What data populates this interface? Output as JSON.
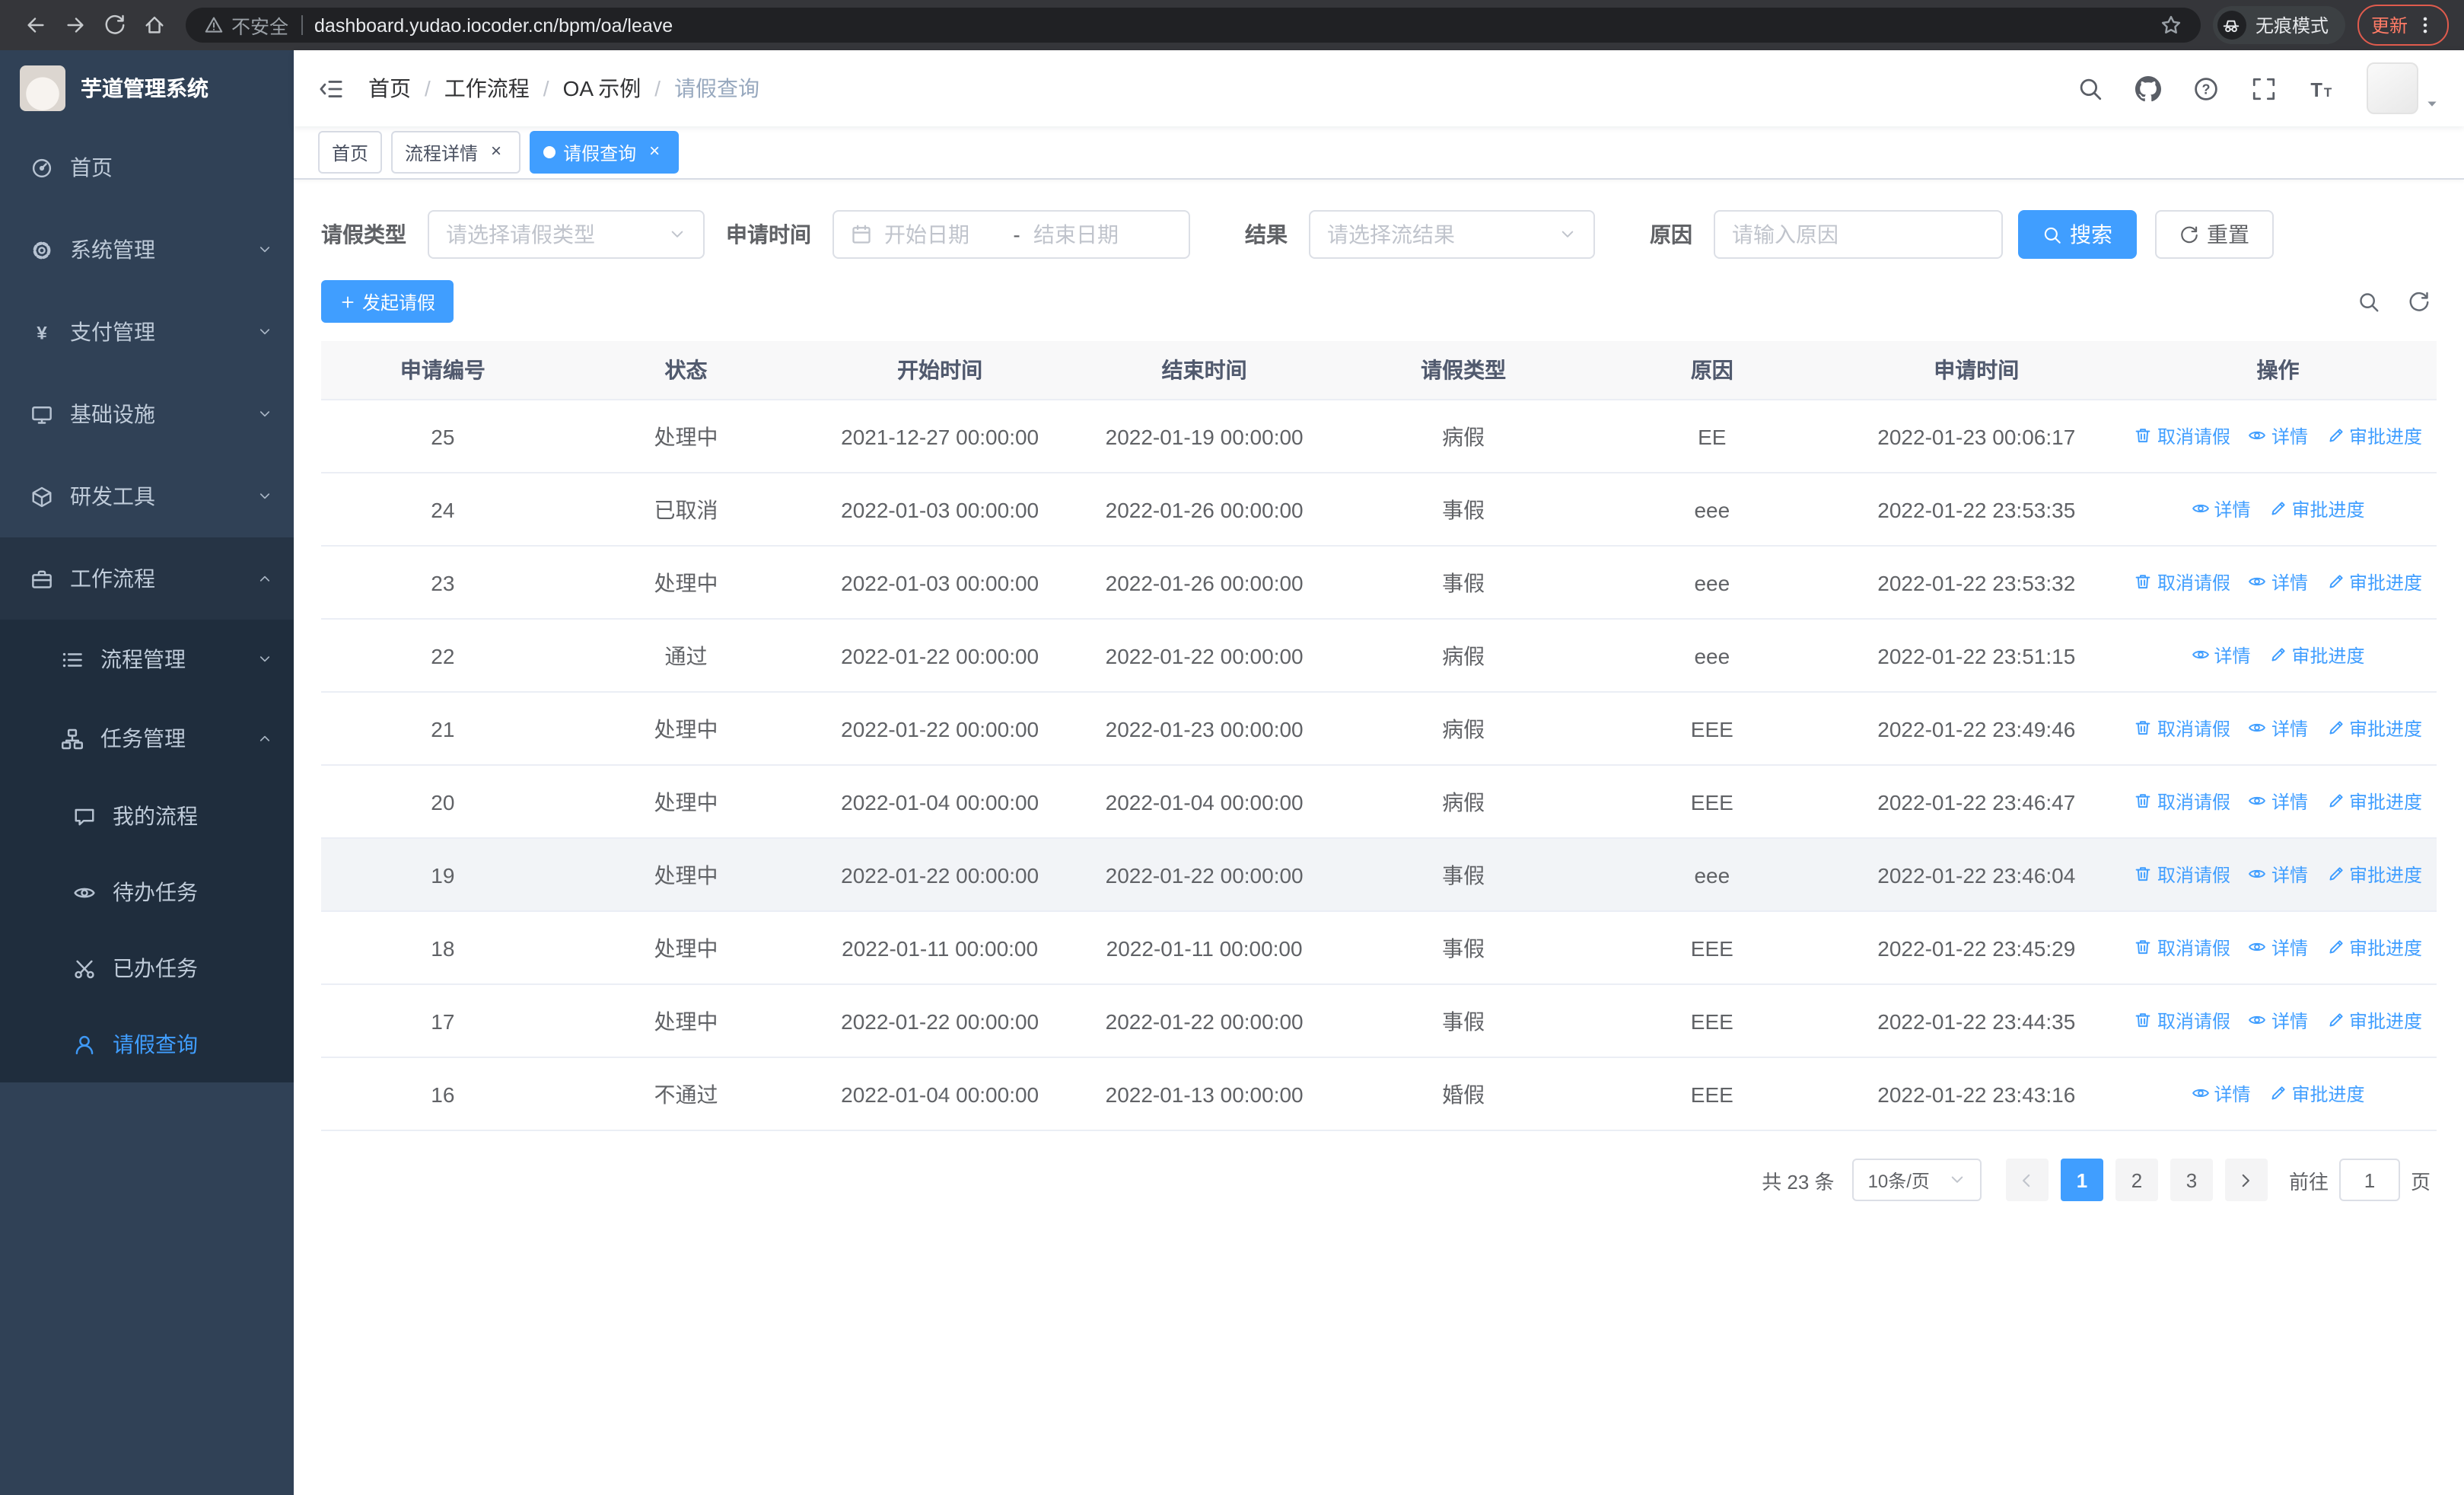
{
  "browser": {
    "security_warning": "不安全",
    "url": "dashboard.yudao.iocoder.cn/bpm/oa/leave",
    "incognito_label": "无痕模式",
    "update_label": "更新"
  },
  "sidebar": {
    "logo_title": "芋道管理系统",
    "menu": [
      {
        "name": "home",
        "label": "首页",
        "icon": "dashboard-icon",
        "level": 1
      },
      {
        "name": "system-management",
        "label": "系统管理",
        "icon": "gear-icon",
        "level": 1,
        "arrow": "down"
      },
      {
        "name": "payment-management",
        "label": "支付管理",
        "icon": "yen-icon",
        "level": 1,
        "arrow": "down"
      },
      {
        "name": "infrastructure",
        "label": "基础设施",
        "icon": "monitor-icon",
        "level": 1,
        "arrow": "down"
      },
      {
        "name": "dev-tools",
        "label": "研发工具",
        "icon": "tools-icon",
        "level": 1,
        "arrow": "down"
      },
      {
        "name": "workflow",
        "label": "工作流程",
        "icon": "briefcase-icon",
        "level": 1,
        "arrow": "up",
        "highlight": true
      },
      {
        "name": "process-management",
        "label": "流程管理",
        "icon": "list-icon",
        "level": 2,
        "arrow": "down",
        "dark": true
      },
      {
        "name": "task-management",
        "label": "任务管理",
        "icon": "tree-icon",
        "level": 2,
        "arrow": "up",
        "dark": true
      },
      {
        "name": "my-process",
        "label": "我的流程",
        "icon": "message-icon",
        "level": 3,
        "dark": true
      },
      {
        "name": "todo-tasks",
        "label": "待办任务",
        "icon": "eye-icon",
        "level": 3,
        "dark": true
      },
      {
        "name": "done-tasks",
        "label": "已办任务",
        "icon": "scissors-icon",
        "level": 3,
        "dark": true
      },
      {
        "name": "leave-query",
        "label": "请假查询",
        "icon": "user-icon",
        "level": 3,
        "dark": true,
        "active": true
      }
    ]
  },
  "header": {
    "breadcrumb": [
      "首页",
      "工作流程",
      "OA 示例",
      "请假查询"
    ]
  },
  "tabs": [
    {
      "name": "home",
      "label": "首页",
      "closable": false,
      "active": false
    },
    {
      "name": "process-detail",
      "label": "流程详情",
      "closable": true,
      "active": false
    },
    {
      "name": "leave-query",
      "label": "请假查询",
      "closable": true,
      "active": true
    }
  ],
  "filters": {
    "leave_type_label": "请假类型",
    "leave_type_placeholder": "请选择请假类型",
    "apply_time_label": "申请时间",
    "start_date_placeholder": "开始日期",
    "range_separator": "-",
    "end_date_placeholder": "结束日期",
    "result_label": "结果",
    "result_placeholder": "请选择流结果",
    "reason_label": "原因",
    "reason_placeholder": "请输入原因",
    "search_button": "搜索",
    "reset_button": "重置"
  },
  "toolbar": {
    "create_button": "发起请假"
  },
  "table": {
    "columns": [
      "申请编号",
      "状态",
      "开始时间",
      "结束时间",
      "请假类型",
      "原因",
      "申请时间",
      "操作"
    ],
    "action_cancel": "取消请假",
    "action_detail": "详情",
    "action_progress": "审批进度",
    "rows": [
      {
        "id": "25",
        "status": "处理中",
        "start": "2021-12-27 00:00:00",
        "end": "2022-01-19 00:00:00",
        "type": "病假",
        "reason": "EE",
        "applied": "2022-01-23 00:06:17",
        "cancellable": true,
        "highlighted": false
      },
      {
        "id": "24",
        "status": "已取消",
        "start": "2022-01-03 00:00:00",
        "end": "2022-01-26 00:00:00",
        "type": "事假",
        "reason": "eee",
        "applied": "2022-01-22 23:53:35",
        "cancellable": false,
        "highlighted": false
      },
      {
        "id": "23",
        "status": "处理中",
        "start": "2022-01-03 00:00:00",
        "end": "2022-01-26 00:00:00",
        "type": "事假",
        "reason": "eee",
        "applied": "2022-01-22 23:53:32",
        "cancellable": true,
        "highlighted": false
      },
      {
        "id": "22",
        "status": "通过",
        "start": "2022-01-22 00:00:00",
        "end": "2022-01-22 00:00:00",
        "type": "病假",
        "reason": "eee",
        "applied": "2022-01-22 23:51:15",
        "cancellable": false,
        "highlighted": false
      },
      {
        "id": "21",
        "status": "处理中",
        "start": "2022-01-22 00:00:00",
        "end": "2022-01-23 00:00:00",
        "type": "病假",
        "reason": "EEE",
        "applied": "2022-01-22 23:49:46",
        "cancellable": true,
        "highlighted": false
      },
      {
        "id": "20",
        "status": "处理中",
        "start": "2022-01-04 00:00:00",
        "end": "2022-01-04 00:00:00",
        "type": "病假",
        "reason": "EEE",
        "applied": "2022-01-22 23:46:47",
        "cancellable": true,
        "highlighted": false
      },
      {
        "id": "19",
        "status": "处理中",
        "start": "2022-01-22 00:00:00",
        "end": "2022-01-22 00:00:00",
        "type": "事假",
        "reason": "eee",
        "applied": "2022-01-22 23:46:04",
        "cancellable": true,
        "highlighted": true
      },
      {
        "id": "18",
        "status": "处理中",
        "start": "2022-01-11 00:00:00",
        "end": "2022-01-11 00:00:00",
        "type": "事假",
        "reason": "EEE",
        "applied": "2022-01-22 23:45:29",
        "cancellable": true,
        "highlighted": false
      },
      {
        "id": "17",
        "status": "处理中",
        "start": "2022-01-22 00:00:00",
        "end": "2022-01-22 00:00:00",
        "type": "事假",
        "reason": "EEE",
        "applied": "2022-01-22 23:44:35",
        "cancellable": true,
        "highlighted": false
      },
      {
        "id": "16",
        "status": "不通过",
        "start": "2022-01-04 00:00:00",
        "end": "2022-01-13 00:00:00",
        "type": "婚假",
        "reason": "EEE",
        "applied": "2022-01-22 23:43:16",
        "cancellable": false,
        "highlighted": false
      }
    ]
  },
  "pagination": {
    "total_text": "共 23 条",
    "page_size": "10条/页",
    "pages": [
      "1",
      "2",
      "3"
    ],
    "active_page": "1",
    "goto_label": "前往",
    "goto_value": "1",
    "goto_suffix": "页"
  },
  "colors": {
    "primary": "#409eff",
    "sidebar_bg": "#304156",
    "submenu_bg": "#1f2d3d",
    "update_warning": "#ff7b66"
  }
}
